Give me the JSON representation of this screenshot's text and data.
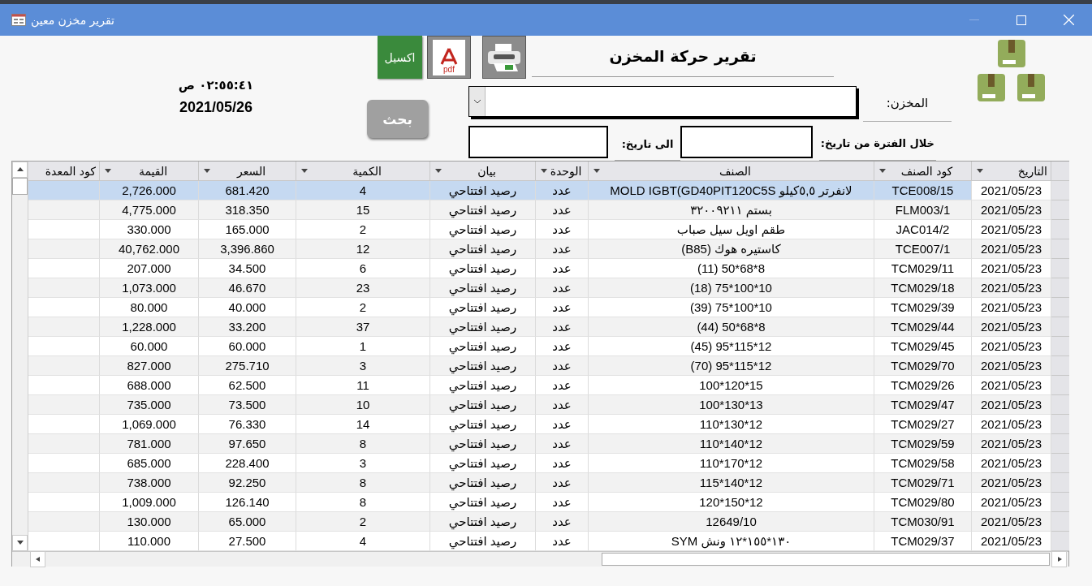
{
  "window": {
    "title": "تقرير مخزن معين"
  },
  "header": {
    "title": "تقرير حركة المخزن",
    "excel_button": "اكسيل",
    "pdf_label": "pdf",
    "store_label": "المخزن:",
    "from_label": "خلال الفترة من تاريخ:",
    "to_label": "الى تاريخ:",
    "search_button": "بحث",
    "time": "٠٢:٥٥:٤١ ص",
    "date": "2021/05/26"
  },
  "table": {
    "columns": [
      "التاريخ",
      "كود الصنف",
      "الصنف",
      "الوحدة",
      "بيان",
      "الكمية",
      "السعر",
      "القيمة",
      "كود المعدة"
    ],
    "rows": [
      {
        "selected": true,
        "cells": [
          "2021/05/23",
          "TCE008/15",
          "لانفرتر ٥,٥كيلو MOLD IGBT(GD40PIT120C5S",
          "عدد",
          "رصيد افتتاحي",
          "4",
          "681.420",
          "2,726.000"
        ]
      },
      {
        "selected": false,
        "cells": [
          "2021/05/23",
          "FLM003/1",
          "بستم ٣٢٠٠٩٢١١",
          "عدد",
          "رصيد افتتاحي",
          "15",
          "318.350",
          "4,775.000"
        ]
      },
      {
        "selected": false,
        "cells": [
          "2021/05/23",
          "JAC014/2",
          "طقم اويل سيل صباب",
          "عدد",
          "رصيد افتتاحي",
          "2",
          "165.000",
          "330.000"
        ]
      },
      {
        "selected": false,
        "cells": [
          "2021/05/23",
          "TCE007/1",
          "كاستيره هوك (B85)",
          "عدد",
          "رصيد افتتاحي",
          "12",
          "3,396.860",
          "40,762.000"
        ]
      },
      {
        "selected": false,
        "cells": [
          "2021/05/23",
          "TCM029/11",
          "(11) 50*68*8",
          "عدد",
          "رصيد افتتاحي",
          "6",
          "34.500",
          "207.000"
        ]
      },
      {
        "selected": false,
        "cells": [
          "2021/05/23",
          "TCM029/18",
          "(18) 75*100*10",
          "عدد",
          "رصيد افتتاحي",
          "23",
          "46.670",
          "1,073.000"
        ]
      },
      {
        "selected": false,
        "cells": [
          "2021/05/23",
          "TCM029/39",
          "(39) 75*100*10",
          "عدد",
          "رصيد افتتاحي",
          "2",
          "40.000",
          "80.000"
        ]
      },
      {
        "selected": false,
        "cells": [
          "2021/05/23",
          "TCM029/44",
          "(44) 50*68*8",
          "عدد",
          "رصيد افتتاحي",
          "37",
          "33.200",
          "1,228.000"
        ]
      },
      {
        "selected": false,
        "cells": [
          "2021/05/23",
          "TCM029/45",
          "(45) 95*115*12",
          "عدد",
          "رصيد افتتاحي",
          "1",
          "60.000",
          "60.000"
        ]
      },
      {
        "selected": false,
        "cells": [
          "2021/05/23",
          "TCM029/70",
          "(70) 95*115*12",
          "عدد",
          "رصيد افتتاحي",
          "3",
          "275.710",
          "827.000"
        ]
      },
      {
        "selected": false,
        "cells": [
          "2021/05/23",
          "TCM029/26",
          "100*120*15",
          "عدد",
          "رصيد افتتاحي",
          "11",
          "62.500",
          "688.000"
        ]
      },
      {
        "selected": false,
        "cells": [
          "2021/05/23",
          "TCM029/47",
          "100*130*13",
          "عدد",
          "رصيد افتتاحي",
          "10",
          "73.500",
          "735.000"
        ]
      },
      {
        "selected": false,
        "cells": [
          "2021/05/23",
          "TCM029/27",
          "110*130*12",
          "عدد",
          "رصيد افتتاحي",
          "14",
          "76.330",
          "1,069.000"
        ]
      },
      {
        "selected": false,
        "cells": [
          "2021/05/23",
          "TCM029/59",
          "110*140*12",
          "عدد",
          "رصيد افتتاحي",
          "8",
          "97.650",
          "781.000"
        ]
      },
      {
        "selected": false,
        "cells": [
          "2021/05/23",
          "TCM029/58",
          "110*170*12",
          "عدد",
          "رصيد افتتاحي",
          "3",
          "228.400",
          "685.000"
        ]
      },
      {
        "selected": false,
        "cells": [
          "2021/05/23",
          "TCM029/71",
          "115*140*12",
          "عدد",
          "رصيد افتتاحي",
          "8",
          "92.250",
          "738.000"
        ]
      },
      {
        "selected": false,
        "cells": [
          "2021/05/23",
          "TCM029/80",
          "120*150*12",
          "عدد",
          "رصيد افتتاحي",
          "8",
          "126.140",
          "1,009.000"
        ]
      },
      {
        "selected": false,
        "cells": [
          "2021/05/23",
          "TCM030/91",
          "12649/10",
          "عدد",
          "رصيد افتتاحي",
          "2",
          "65.000",
          "130.000"
        ]
      },
      {
        "selected": false,
        "cells": [
          "2021/05/23",
          "TCM029/37",
          "١٣٠*١٥٥*١٢ ونش SYM",
          "عدد",
          "رصيد افتتاحي",
          "4",
          "27.500",
          "110.000"
        ]
      }
    ]
  }
}
